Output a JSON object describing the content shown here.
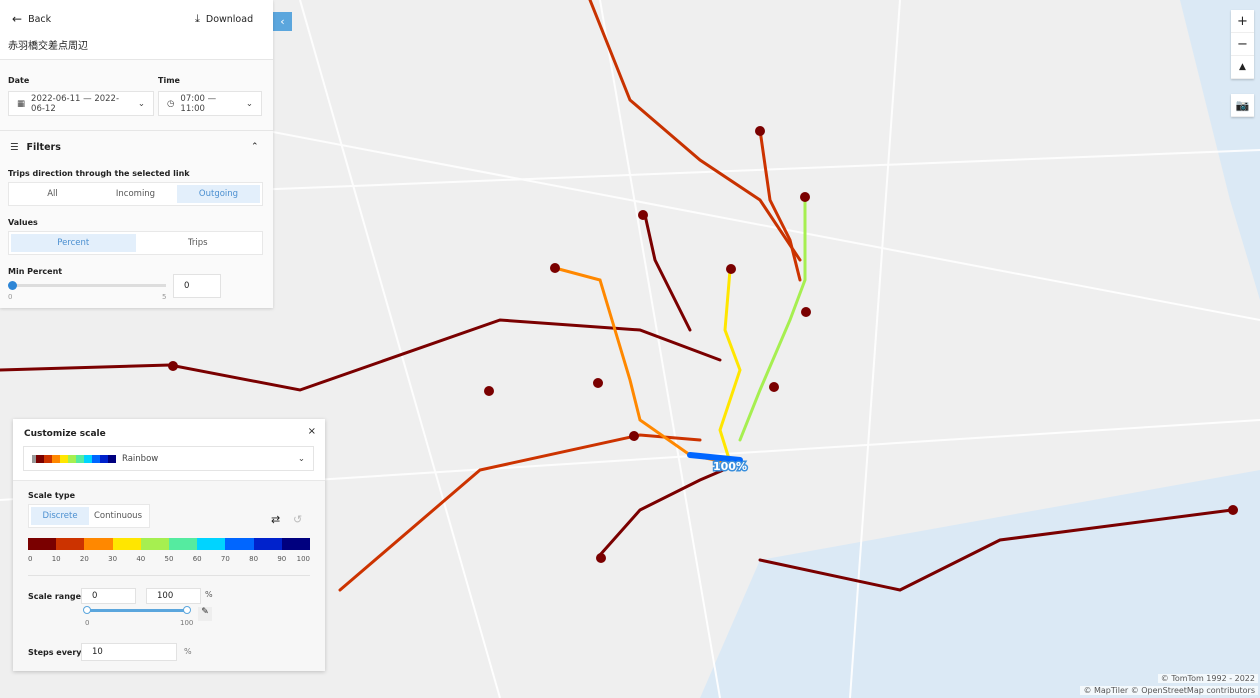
{
  "header": {
    "back_label": "Back",
    "download_label": "Download",
    "location_title": "赤羽橋交差点周辺"
  },
  "date": {
    "label": "Date",
    "value": "2022-06-11 — 2022-06-12"
  },
  "time": {
    "label": "Time",
    "value": "07:00 — 11:00"
  },
  "filters": {
    "title": "Filters",
    "direction_label": "Trips direction through the selected link",
    "direction_options": [
      "All",
      "Incoming",
      "Outgoing"
    ],
    "direction_selected": "Outgoing",
    "values_label": "Values",
    "values_options": [
      "Percent",
      "Trips"
    ],
    "values_selected": "Percent",
    "min_percent_label": "Min Percent",
    "min_percent_value": "0",
    "slider_min": "0",
    "slider_max": "5"
  },
  "map": {
    "selected_link_label": "100%",
    "attribution_tomtom": "© TomTom 1992 - 2022",
    "attribution_osm": "© MapTiler © OpenStreetMap contributors"
  },
  "scale": {
    "title": "Customize scale",
    "palette_name": "Rainbow",
    "scale_type_label": "Scale type",
    "scale_types": [
      "Discrete",
      "Continuous"
    ],
    "scale_type_selected": "Discrete",
    "colors": [
      "#7a0000",
      "#cc3300",
      "#ff8800",
      "#ffe600",
      "#a6ef50",
      "#55eba0",
      "#00d4ff",
      "#0066ff",
      "#0022cc",
      "#00007f"
    ],
    "ticks": [
      "0",
      "10",
      "20",
      "30",
      "40",
      "50",
      "60",
      "70",
      "80",
      "90",
      "100"
    ],
    "range_label": "Scale range",
    "range_min": "0",
    "range_max": "100",
    "range_unit": "%",
    "range_slider_min": "0",
    "range_slider_max": "100",
    "steps_label": "Steps every",
    "steps_value": "10",
    "steps_unit": "%"
  }
}
